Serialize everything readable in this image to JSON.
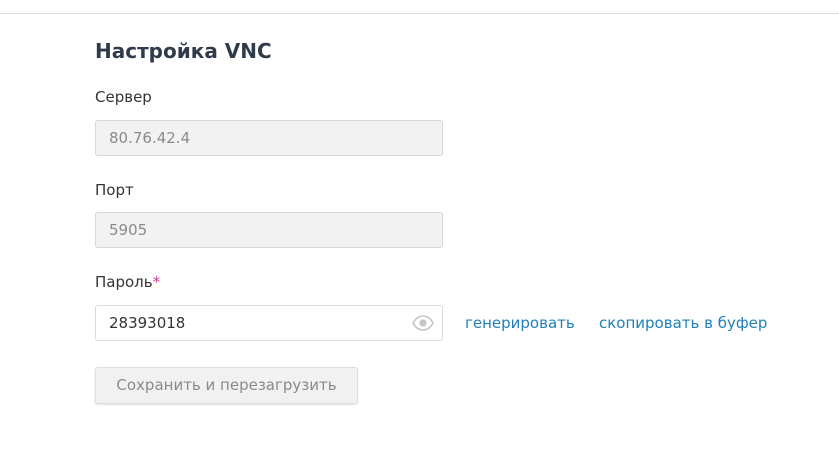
{
  "form": {
    "title": "Настройка VNC",
    "server": {
      "label": "Сервер",
      "value": "80.76.42.4"
    },
    "port": {
      "label": "Порт",
      "value": "5905"
    },
    "password": {
      "label": "Пароль",
      "required_mark": "*",
      "value": "28393018",
      "toggle_icon": "eye-icon"
    },
    "links": {
      "generate": "генерировать",
      "copy": "скопировать в буфер"
    },
    "save_button": "Сохранить и перезагрузить"
  },
  "colors": {
    "link": "#1f7fb6",
    "required": "#d63384",
    "title": "#2f3b4a",
    "readonly_bg": "#f2f2f2"
  }
}
